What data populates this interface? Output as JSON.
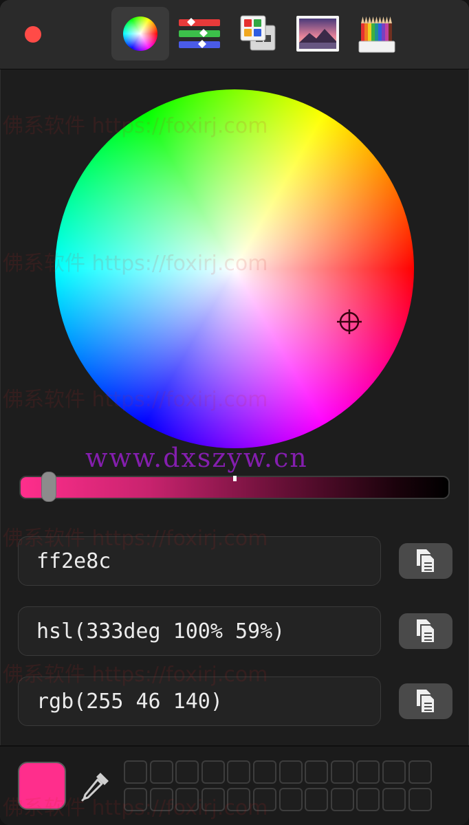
{
  "current_color": "#ff2e8c",
  "toolbar": {
    "tabs": [
      {
        "name": "color-wheel",
        "icon": "color-wheel-icon",
        "active": true
      },
      {
        "name": "color-sliders",
        "icon": "sliders-icon",
        "active": false
      },
      {
        "name": "color-palettes",
        "icon": "palettes-icon",
        "active": false
      },
      {
        "name": "image-palettes",
        "icon": "image-icon",
        "active": false
      },
      {
        "name": "pencils",
        "icon": "pencils-icon",
        "active": false
      }
    ]
  },
  "wheel": {
    "selected_hue_deg": 333
  },
  "brightness_slider": {
    "value": 1.0
  },
  "values": {
    "hex": "ff2e8c",
    "hsl": "hsl(333deg 100% 59%)",
    "rgb": "rgb(255 46 140)"
  },
  "copy_button": {
    "icon": "copy-icon"
  },
  "bottom": {
    "eyedropper_icon": "eyedropper-icon",
    "swatch_slots": 24
  },
  "watermarks": {
    "cn": "佛系软件 https://foxirj.com",
    "site": "www.dxszyw.cn"
  }
}
